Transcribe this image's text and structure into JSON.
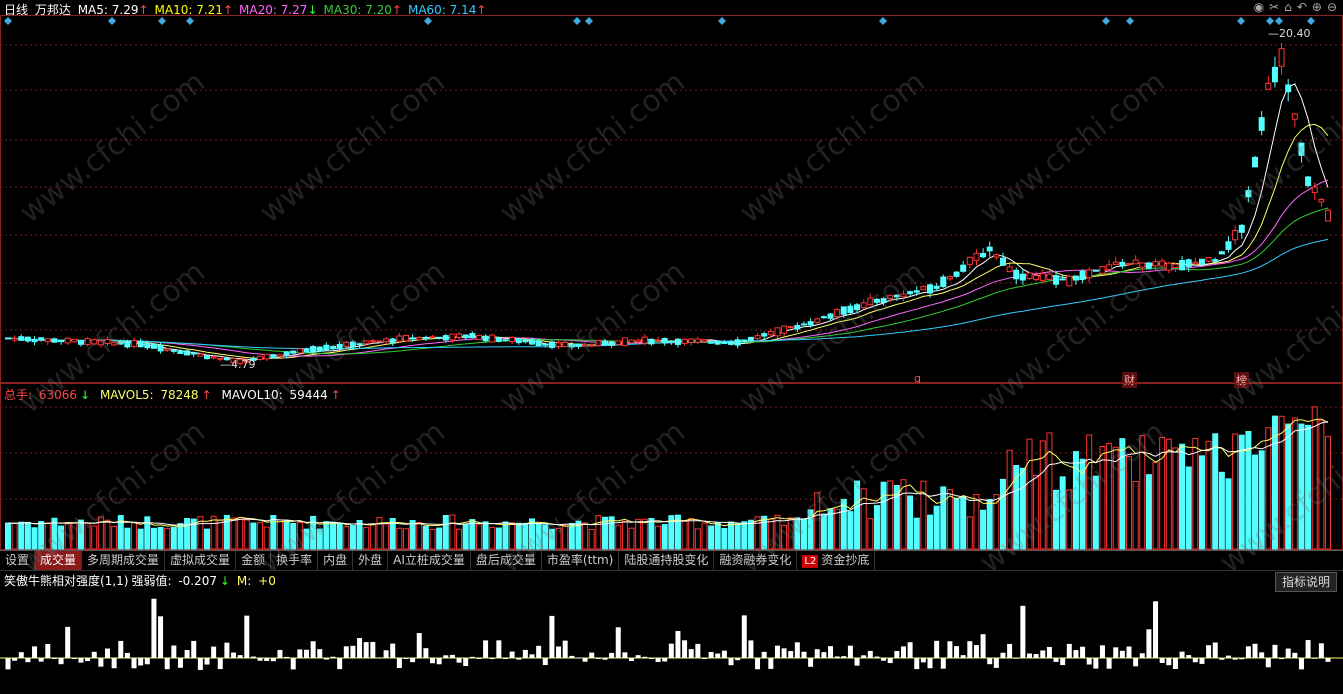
{
  "header": {
    "period": "日线",
    "stock_name": "万邦达",
    "ma": [
      {
        "label": "MA5:",
        "value": "7.29",
        "arrow": "↑",
        "color": "#ffffff"
      },
      {
        "label": "MA10:",
        "value": "7.21",
        "arrow": "↑",
        "color": "#ffff00"
      },
      {
        "label": "MA20:",
        "value": "7.27",
        "arrow": "↓",
        "color": "#ff66ff"
      },
      {
        "label": "MA30:",
        "value": "7.20",
        "arrow": "↑",
        "color": "#33cc33"
      },
      {
        "label": "MA60:",
        "value": "7.14",
        "arrow": "↑",
        "color": "#33ccff"
      }
    ]
  },
  "toolbar_icons": [
    "eye-icon",
    "scissors-icon",
    "lock-icon",
    "undo-icon",
    "plus-circle-icon",
    "minus-circle-icon"
  ],
  "volume_legend": {
    "total_label": "总手:",
    "total_value": "63066",
    "total_arrow": "↓",
    "mavol5_label": "MAVOL5:",
    "mavol5_value": "78248",
    "mavol5_arrow": "↑",
    "mavol10_label": "MAVOL10:",
    "mavol10_value": "59444",
    "mavol10_arrow": "↑"
  },
  "tabs": [
    {
      "label": "设置"
    },
    {
      "label": "成交量",
      "active": true
    },
    {
      "label": "多周期成交量"
    },
    {
      "label": "虚拟成交量"
    },
    {
      "label": "金额"
    },
    {
      "label": "换手率"
    },
    {
      "label": "内盘"
    },
    {
      "label": "外盘"
    },
    {
      "label": "AI立桩成交量"
    },
    {
      "label": "盘后成交量"
    },
    {
      "label": "市盈率(ttm)"
    },
    {
      "label": "陆股通持股变化"
    },
    {
      "label": "融资融券变化"
    },
    {
      "label": "资金抄底",
      "badge": "L2"
    }
  ],
  "indicator": {
    "name": "笑傲牛熊相对强度(1,1)",
    "strength_label": "强弱值:",
    "strength_value": "-0.207",
    "strength_arrow": "↓",
    "m_label": "M:",
    "m_value": "+0",
    "explain_button": "指标说明"
  },
  "markers": [
    {
      "text": "q"
    },
    {
      "text": "财"
    },
    {
      "text": "榜"
    }
  ],
  "watermark_text": "www.cfchi.com",
  "chart_data": {
    "type": "candlestick",
    "high_label": "20.40",
    "low_label": "4.79",
    "price_ylim": [
      4.3,
      21.5
    ],
    "colors": {
      "up": "#ff3333",
      "down": "#54ffff",
      "ma5": "#ffffff",
      "ma10": "#ffff66",
      "ma20": "#ff66ff",
      "ma30": "#33cc33",
      "ma60": "#33ccff",
      "grid": "#7a1f1f"
    }
  }
}
